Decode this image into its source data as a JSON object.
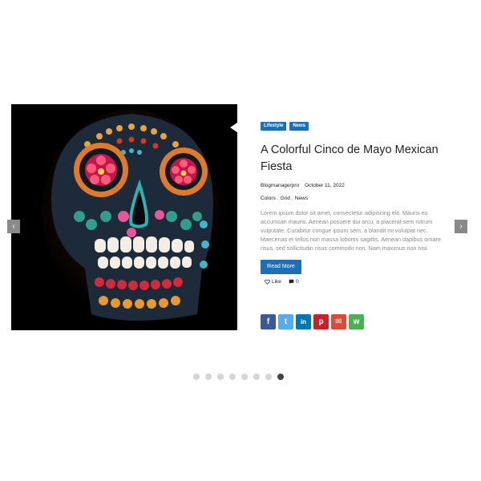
{
  "slide": {
    "categories": [
      "Lifestyle",
      "News"
    ],
    "title": "A Colorful Cinco de Mayo Mexican Fiesta",
    "author": "Blogmanagerpro",
    "date": "October 11, 2022",
    "tags": [
      "Colors",
      "Grid",
      "News"
    ],
    "tag_separator": ",",
    "excerpt": "Lorem ipsum dolor sit amet, consectetur adipiscing elit. Mauris eu accumsan mauris. Aenean posuere dui arcu, a placerat sem rutrum vulputate. Curabitur congue ipsum sem, a blandit mi volutpat nec. Maecenas et tellus non massa lobortis sagittis. Aenean dapibus ornare risus, sed sollicitudin risus commodo non. Nam maximus non nisi",
    "read_more_label": "Read More",
    "like_label": "Like",
    "comment_count": "0"
  },
  "nav": {
    "prev_glyph": "‹",
    "next_glyph": "›"
  },
  "share": [
    {
      "name": "facebook",
      "glyph": "f",
      "color": "#3b5998"
    },
    {
      "name": "twitter",
      "glyph": "t",
      "color": "#55acee"
    },
    {
      "name": "linkedin",
      "glyph": "in",
      "color": "#0077b5"
    },
    {
      "name": "pinterest",
      "glyph": "p",
      "color": "#cb2027"
    },
    {
      "name": "email",
      "glyph": "✉",
      "color": "#dd4b39"
    },
    {
      "name": "whatsapp",
      "glyph": "w",
      "color": "#4caf50"
    }
  ],
  "pager": {
    "count": 8,
    "active": 8
  },
  "colors": {
    "accent": "#1e6fb8",
    "arrow": "#8a8a8a"
  }
}
